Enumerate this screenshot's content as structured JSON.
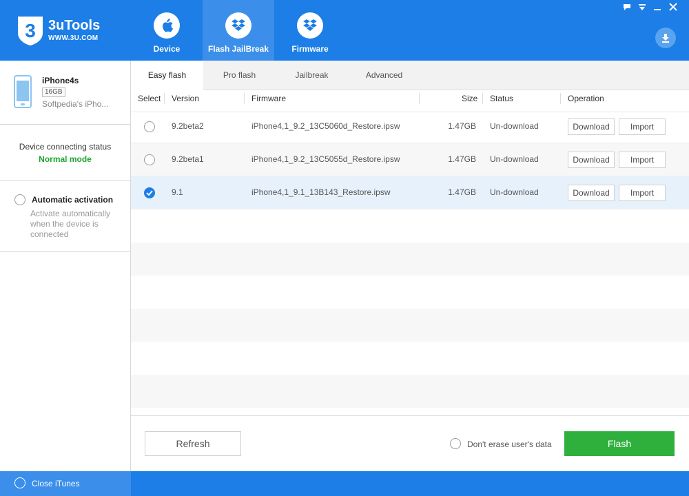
{
  "app": {
    "name": "3uTools",
    "url": "WWW.3U.COM"
  },
  "nav": [
    {
      "label": "Device",
      "icon": "apple-icon",
      "active": false
    },
    {
      "label": "Flash JailBreak",
      "icon": "box-icon",
      "active": true
    },
    {
      "label": "Firmware",
      "icon": "box-icon",
      "active": false
    }
  ],
  "device": {
    "name": "iPhone4s",
    "capacity": "16GB",
    "description": "Softpedia's iPho...",
    "status_label": "Device connecting status",
    "status_value": "Normal mode"
  },
  "auto_activation": {
    "title": "Automatic activation",
    "description": "Activate automatically when the device is connected"
  },
  "close_itunes": "Close iTunes",
  "tabs": [
    "Easy flash",
    "Pro flash",
    "Jailbreak",
    "Advanced"
  ],
  "table": {
    "headers": {
      "select": "Select",
      "version": "Version",
      "firmware": "Firmware",
      "size": "Size",
      "status": "Status",
      "operation": "Operation"
    },
    "rows": [
      {
        "version": "9.2beta2",
        "firmware": "iPhone4,1_9.2_13C5060d_Restore.ipsw",
        "size": "1.47GB",
        "status": "Un-download",
        "download": "Download",
        "import": "Import",
        "selected": false
      },
      {
        "version": "9.2beta1",
        "firmware": "iPhone4,1_9.2_13C5055d_Restore.ipsw",
        "size": "1.47GB",
        "status": "Un-download",
        "download": "Download",
        "import": "Import",
        "selected": false
      },
      {
        "version": "9.1",
        "firmware": "iPhone4,1_9.1_13B143_Restore.ipsw",
        "size": "1.47GB",
        "status": "Un-download",
        "download": "Download",
        "import": "Import",
        "selected": true
      }
    ]
  },
  "footer": {
    "refresh": "Refresh",
    "erase_label": "Don't erase user's data",
    "flash": "Flash"
  },
  "colors": {
    "brand": "#1c7ee6",
    "success": "#1fa52e",
    "flash": "#2fb03d"
  }
}
